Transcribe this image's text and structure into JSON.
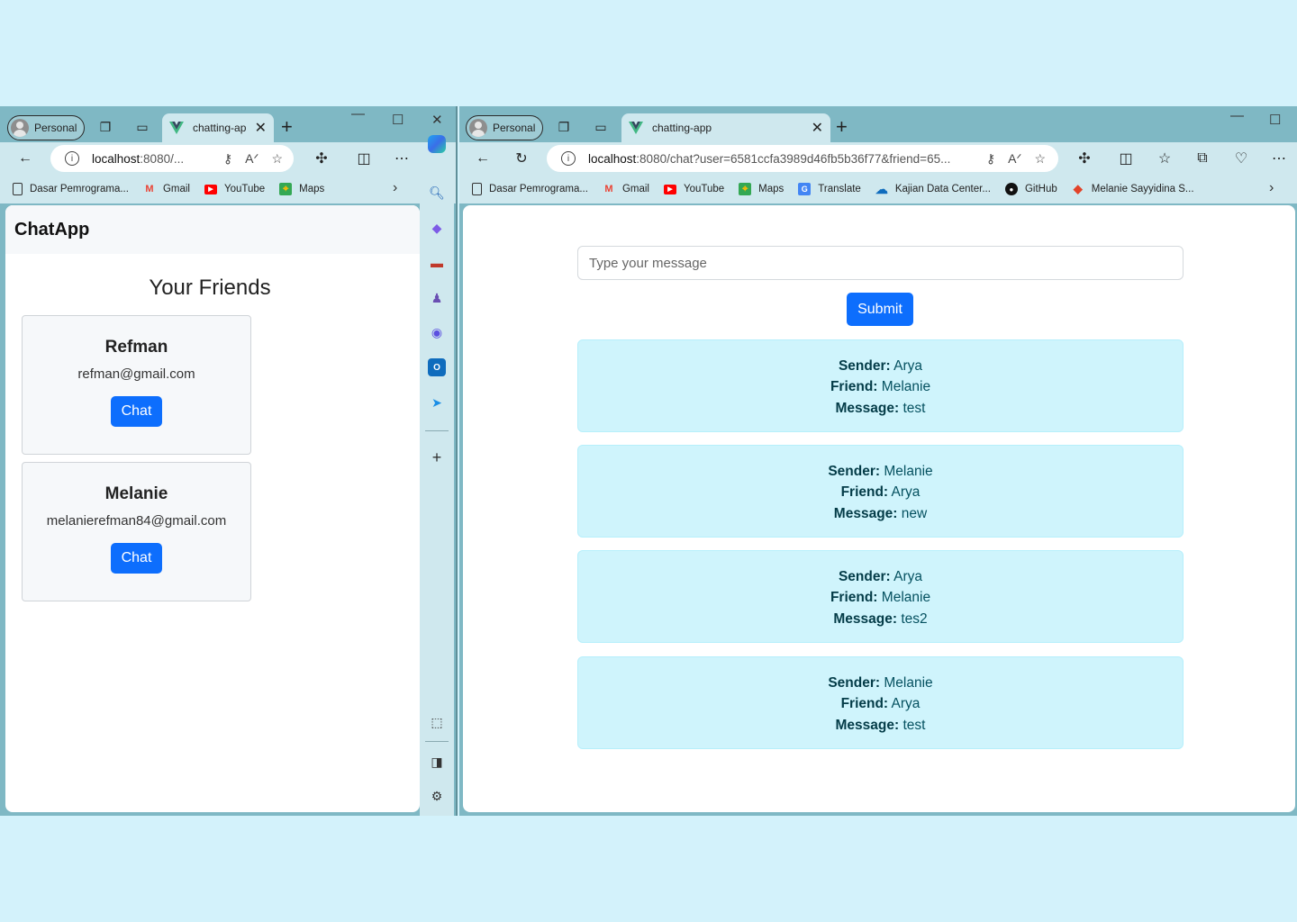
{
  "left_window": {
    "profile_label": "Personal",
    "tab_title": "chatting-ap",
    "url_host": "localhost",
    "url_rest": ":8080/...",
    "bookmarks": [
      "Dasar Pemrograma...",
      "Gmail",
      "YouTube",
      "Maps"
    ],
    "app": {
      "brand": "ChatApp",
      "friends_heading": "Your Friends",
      "friends": [
        {
          "name": "Refman",
          "email": "refman@gmail.com",
          "button": "Chat"
        },
        {
          "name": "Melanie",
          "email": "melanierefman84@gmail.com",
          "button": "Chat"
        }
      ]
    }
  },
  "right_window": {
    "profile_label": "Personal",
    "tab_title": "chatting-app",
    "url_host": "localhost",
    "url_rest": ":8080/chat?user=6581ccfa3989d46fb5b36f77&friend=65...",
    "bookmarks": [
      "Dasar Pemrograma...",
      "Gmail",
      "YouTube",
      "Maps",
      "Translate",
      "Kajian Data Center...",
      "GitHub",
      "Melanie Sayyidina S..."
    ],
    "app": {
      "message_placeholder": "Type your message",
      "submit_label": "Submit",
      "labels": {
        "sender": "Sender:",
        "friend": "Friend:",
        "message": "Message:"
      },
      "messages": [
        {
          "sender": "Arya",
          "friend": "Melanie",
          "message": "test"
        },
        {
          "sender": "Melanie",
          "friend": "Arya",
          "message": "new"
        },
        {
          "sender": "Arya",
          "friend": "Melanie",
          "message": "tes2"
        },
        {
          "sender": "Melanie",
          "friend": "Arya",
          "message": "test"
        }
      ]
    }
  },
  "colors": {
    "primary": "#0d6efd",
    "info_bg": "#cff4fc",
    "info_text": "#055160",
    "desktop_bg": "#d3f2fb"
  }
}
